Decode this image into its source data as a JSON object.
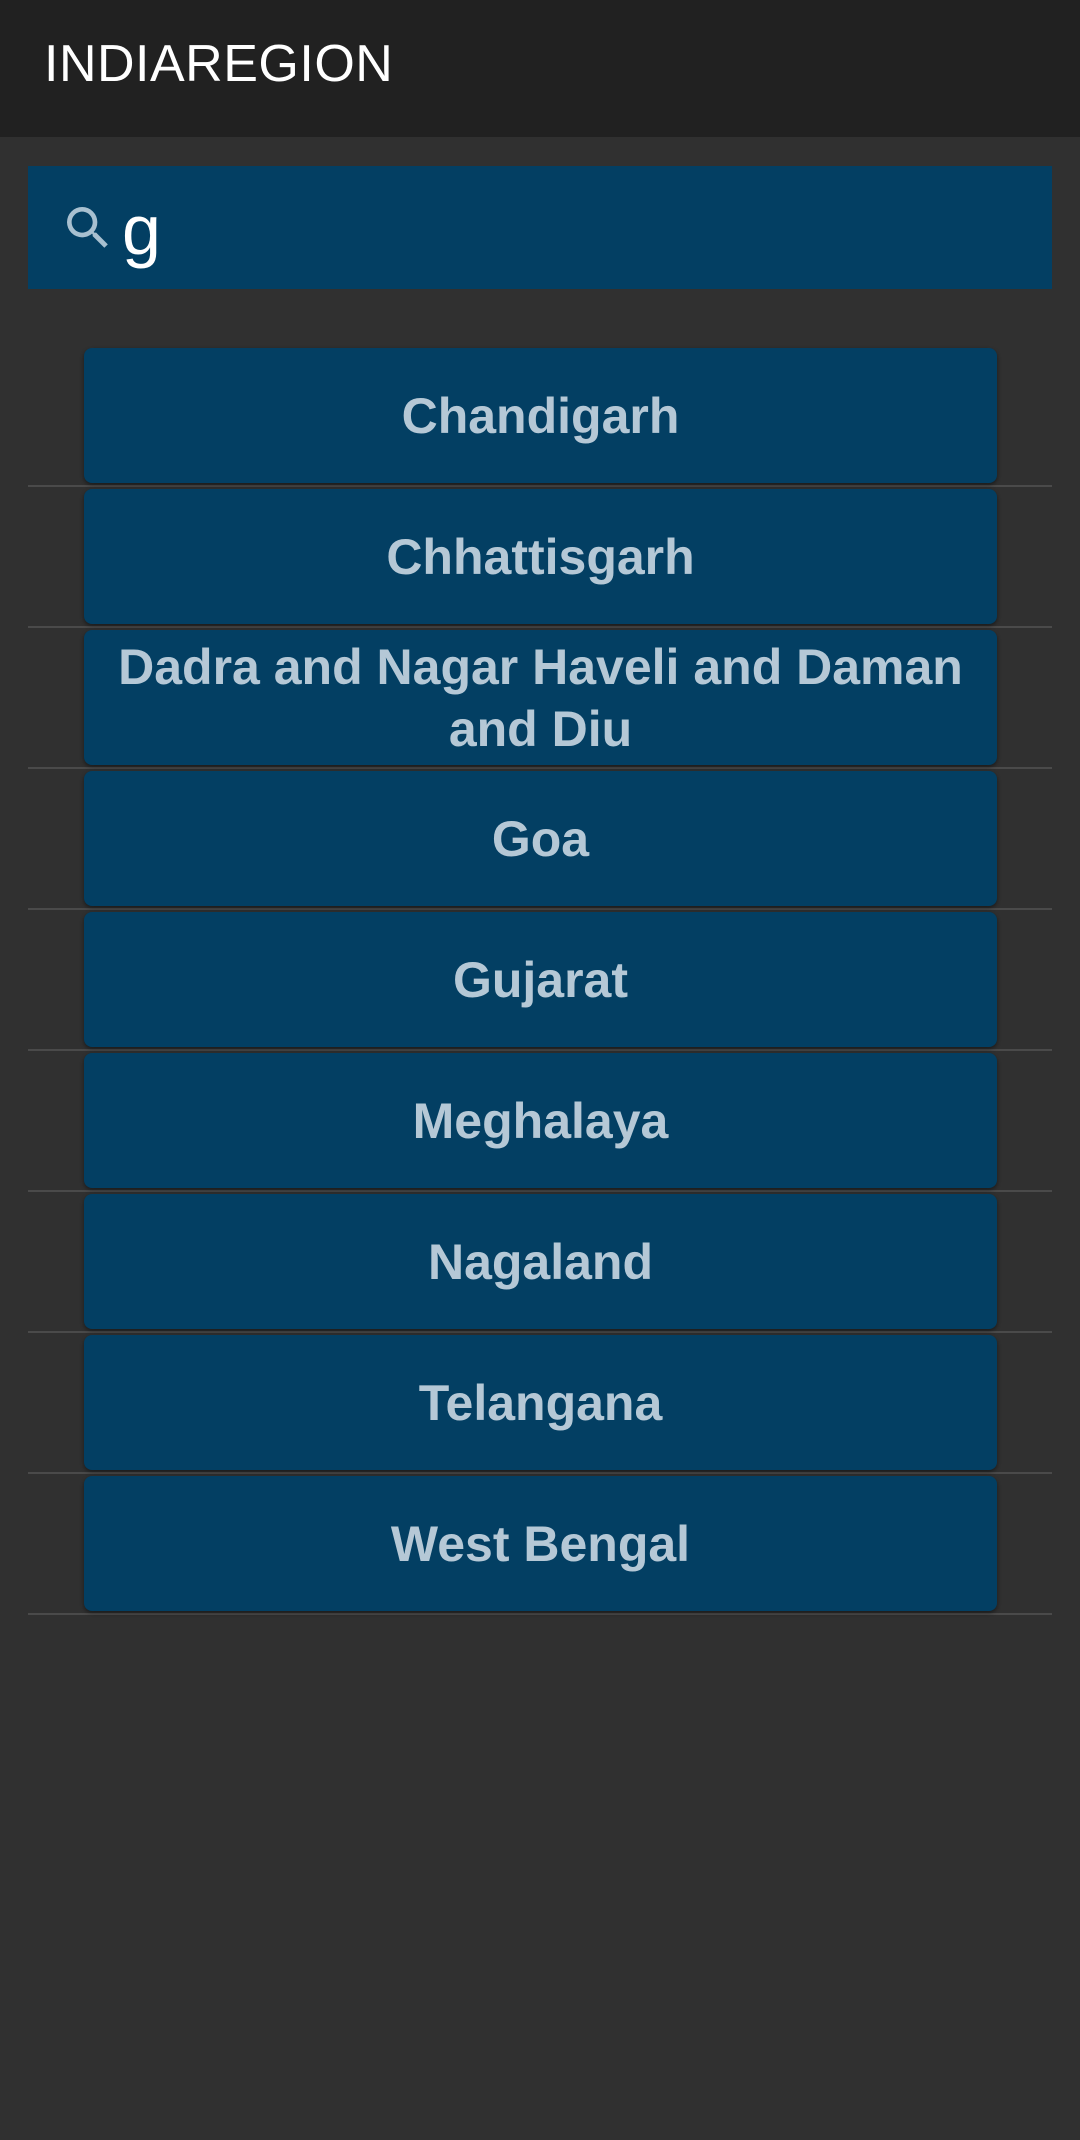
{
  "appbar": {
    "title": "INDIAREGION"
  },
  "search": {
    "icon": "search-icon",
    "value": "g"
  },
  "results": [
    {
      "label": "Chandigarh"
    },
    {
      "label": "Chhattisgarh"
    },
    {
      "label": "Dadra and Nagar Haveli and Daman and Diu"
    },
    {
      "label": "Goa"
    },
    {
      "label": "Gujarat"
    },
    {
      "label": "Meghalaya"
    },
    {
      "label": "Nagaland"
    },
    {
      "label": "Telangana"
    },
    {
      "label": "West Bengal"
    }
  ],
  "colors": {
    "background": "#303030",
    "appbar": "#212121",
    "card": "#033f63",
    "card_text": "#b5c8d6",
    "icon": "#a8c0d0"
  }
}
